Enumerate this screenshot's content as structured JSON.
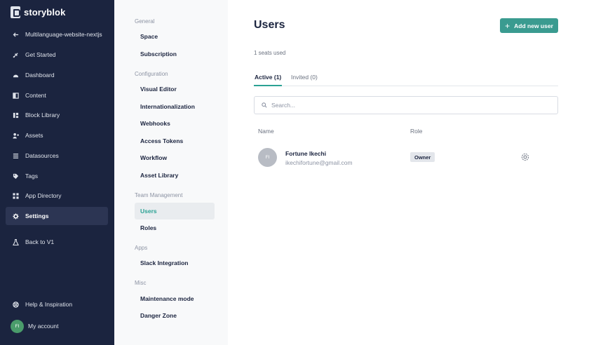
{
  "brand": {
    "name": "storyblok"
  },
  "sidebar": {
    "space_item": {
      "label": "Multilanguage-website-nextjs",
      "icon": "arrow-left-icon"
    },
    "items": [
      {
        "label": "Get Started",
        "icon": "rocket-icon"
      },
      {
        "label": "Dashboard",
        "icon": "dashboard-icon"
      },
      {
        "label": "Content",
        "icon": "content-icon"
      },
      {
        "label": "Block Library",
        "icon": "block-library-icon"
      },
      {
        "label": "Assets",
        "icon": "assets-icon"
      },
      {
        "label": "Datasources",
        "icon": "datasources-icon"
      },
      {
        "label": "Tags",
        "icon": "tag-icon"
      },
      {
        "label": "App Directory",
        "icon": "apps-icon"
      },
      {
        "label": "Settings",
        "icon": "gear-icon"
      }
    ],
    "back_v1": {
      "label": "Back to V1",
      "icon": "flask-icon"
    },
    "help": {
      "label": "Help & Inspiration",
      "icon": "lifebuoy-icon"
    },
    "account": {
      "label": "My account",
      "initials": "FI"
    }
  },
  "settings_menu": {
    "groups": [
      {
        "title": "General",
        "items": [
          "Space",
          "Subscription"
        ]
      },
      {
        "title": "Configuration",
        "items": [
          "Visual Editor",
          "Internationalization",
          "Webhooks",
          "Access Tokens",
          "Workflow",
          "Asset Library"
        ]
      },
      {
        "title": "Team Management",
        "items": [
          "Users",
          "Roles"
        ]
      },
      {
        "title": "Apps",
        "items": [
          "Slack Integration"
        ]
      },
      {
        "title": "Misc",
        "items": [
          "Maintenance mode",
          "Danger Zone"
        ]
      }
    ]
  },
  "main": {
    "title": "Users",
    "add_button": "Add new user",
    "seats": "1 seats used",
    "tabs": [
      "Active (1)",
      "Invited (0)"
    ],
    "search_placeholder": "Search...",
    "columns": {
      "name": "Name",
      "role": "Role"
    },
    "users": [
      {
        "initials": "FI",
        "name": "Fortune Ikechi",
        "email": "ikechifortune@gmail.com",
        "role": "Owner"
      }
    ]
  },
  "colors": {
    "sidebar_bg": "#1b243f",
    "accent": "#2ba294",
    "button": "#3a9b90"
  }
}
